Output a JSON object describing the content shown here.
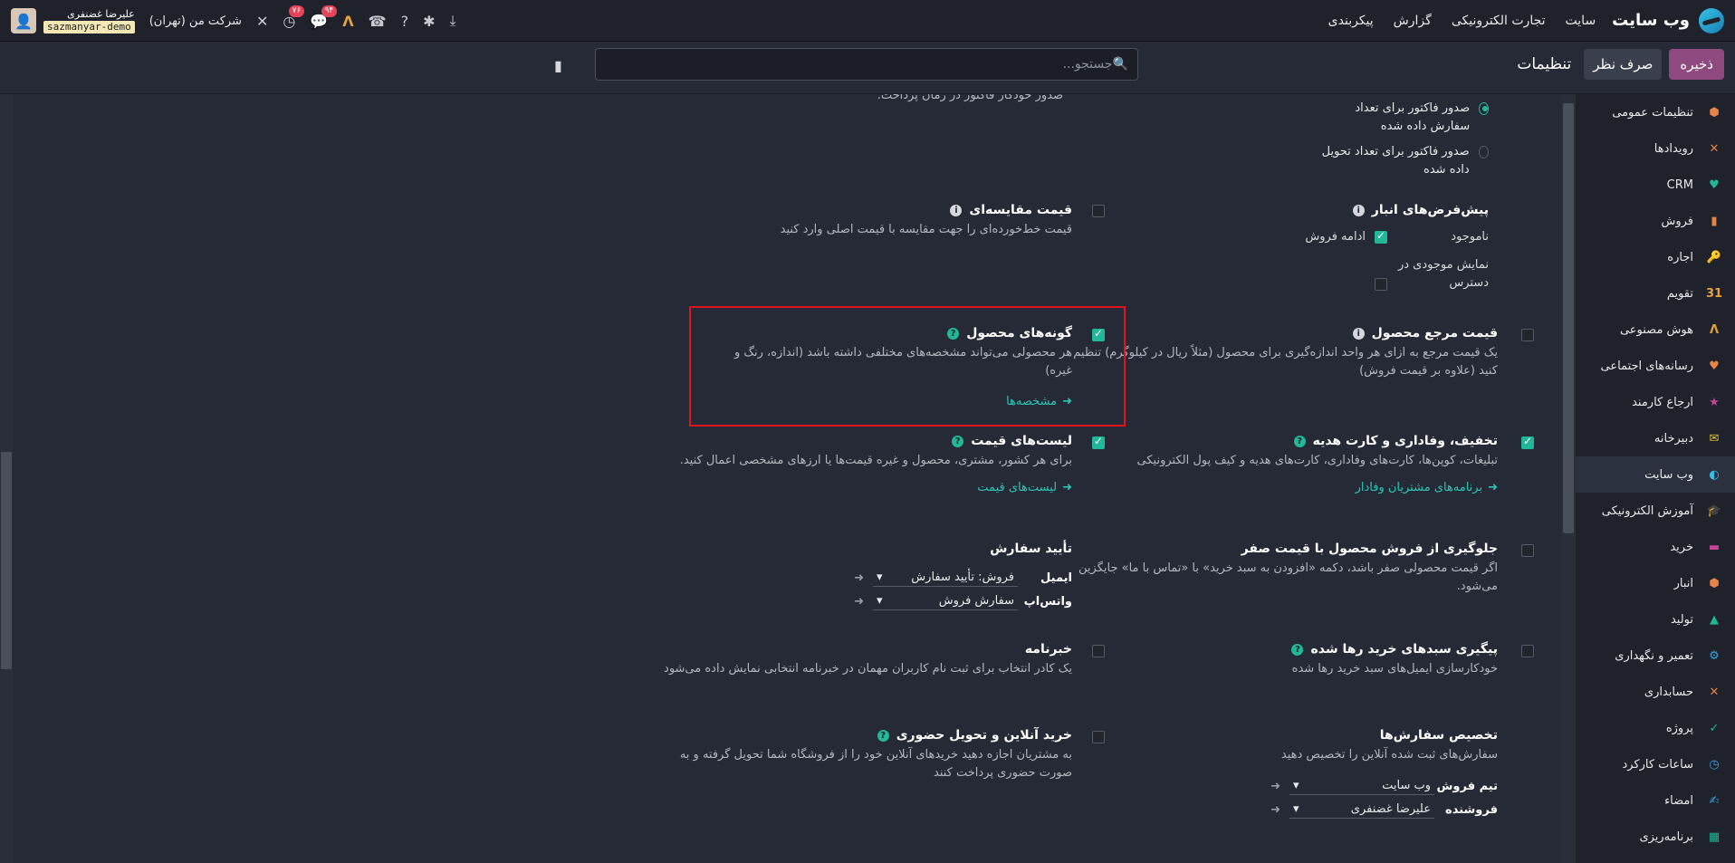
{
  "topbar": {
    "app_name": "وب سایت",
    "menu": [
      "سایت",
      "تجارت الکترونیکی",
      "گزارش",
      "پیکربندی"
    ],
    "user_name": "علیرضا غضنفری",
    "db": "sazmanyar-demo",
    "company": "شرکت من (تهران)",
    "badge_messages": "۹۴",
    "badge_activities": "۷۶"
  },
  "control": {
    "save": "ذخیره",
    "discard": "صرف نظر",
    "title": "تنظیمات",
    "search_placeholder": "جستجو..."
  },
  "sidebar": [
    {
      "label": "تنظیمات عمومی",
      "color": "#E8834A",
      "glyph": "⬢"
    },
    {
      "label": "رویدادها",
      "color": "#E8834A",
      "glyph": "✕"
    },
    {
      "label": "CRM",
      "color": "#21B799",
      "glyph": "♥"
    },
    {
      "label": "فروش",
      "color": "#E8834A",
      "glyph": "▮"
    },
    {
      "label": "اجاره",
      "color": "#C2459A",
      "glyph": "🔑"
    },
    {
      "label": "تقویم",
      "color": "#E8A23A",
      "glyph": "31"
    },
    {
      "label": "هوش مصنوعی",
      "color": "#E8A23A",
      "glyph": "Λ"
    },
    {
      "label": "رسانه‌های اجتماعی",
      "color": "#E8834A",
      "glyph": "♥"
    },
    {
      "label": "ارجاع کارمند",
      "color": "#C2459A",
      "glyph": "★"
    },
    {
      "label": "دبیرخانه",
      "color": "#E8C23A",
      "glyph": "✉"
    },
    {
      "label": "وب سایت",
      "color": "#34C3E6",
      "glyph": "◐"
    },
    {
      "label": "آموزش الکترونیکی",
      "color": "#21B799",
      "glyph": "🎓"
    },
    {
      "label": "خرید",
      "color": "#C2459A",
      "glyph": "▬"
    },
    {
      "label": "انبار",
      "color": "#E8834A",
      "glyph": "⬢"
    },
    {
      "label": "تولید",
      "color": "#21B799",
      "glyph": "▲"
    },
    {
      "label": "تعمیر و نگهداری",
      "color": "#34A3E6",
      "glyph": "⚙"
    },
    {
      "label": "حسابداری",
      "color": "#E8834A",
      "glyph": "✕"
    },
    {
      "label": "پروژه",
      "color": "#21B799",
      "glyph": "✓"
    },
    {
      "label": "ساعات کارکرد",
      "color": "#34A3E6",
      "glyph": "◷"
    },
    {
      "label": "امضاء",
      "color": "#34A3E6",
      "glyph": "✍"
    },
    {
      "label": "برنامه‌ریزی",
      "color": "#21B799",
      "glyph": "▦"
    }
  ],
  "settings": {
    "top_partial": "صدور خودکار فاکتور در زمان پرداخت.",
    "invoice_ordered": "صدور فاکتور برای تعداد سفارش داده شده",
    "invoice_delivered": "صدور فاکتور برای تعداد تحویل داده شده",
    "stock_defaults": {
      "title": "پیش‌فرض‌های انبار",
      "out_label": "ناموجود",
      "continue": "ادامه فروش",
      "show_available": "نمایش موجودی در دسترس"
    },
    "compare_price": {
      "title": "قیمت مقایسه‌ای",
      "desc": "قیمت خط‌خورده‌ای را جهت مقایسه با قیمت اصلی وارد کنید"
    },
    "ref_price": {
      "title": "قیمت مرجع محصول",
      "desc": "یک قیمت مرجع به ازای هر واحد اندازه‌گیری برای محصول (مثلاً ریال در کیلوگرم) تنظیم کنید (علاوه بر قیمت فروش)"
    },
    "variants": {
      "title": "گونه‌های محصول",
      "desc": "هر محصولی می‌تواند مشخصه‌های مختلفی داشته باشد (اندازه، رنگ و غیره)",
      "link": "مشخصه‌ها"
    },
    "loyalty": {
      "title": "تخفیف، وفاداری و کارت هدیه",
      "desc": "تبلیغات، کوپن‌ها، کارت‌های وفاداری، کارت‌های هدیه و کیف پول الکترونیکی",
      "link": "برنامه‌های مشتریان وفادار"
    },
    "pricelists": {
      "title": "لیست‌های قیمت",
      "desc": "برای هر کشور، مشتری، محصول و غیره قیمت‌ها یا ارزهای مشخصی اعمال کنید.",
      "link": "لیست‌های قیمت"
    },
    "zero_price": {
      "title": "جلوگیری از فروش محصول با قیمت صفر",
      "desc": "اگر قیمت محصولی صفر باشد، دکمه «افزودن به سبد خرید» با «تماس با ما» جایگزین می‌شود."
    },
    "order_confirm": {
      "title": "تأیید سفارش",
      "email_label": "ایمیل",
      "email_value": "فروش: تأیید سفارش",
      "whatsapp_label": "واتس‌اپ",
      "whatsapp_value": "سفارش فروش"
    },
    "abandoned": {
      "title": "پیگیری سبدهای خرید رها شده",
      "desc": "خودکارسازی ایمیل‌های سبد خرید رها شده"
    },
    "newsletter": {
      "title": "خبرنامه",
      "desc": "یک کادر انتخاب برای ثبت نام کاربران مهمان در خبرنامه انتخابی نمایش داده می‌شود"
    },
    "assign": {
      "title": "تخصیص سفارش‌ها",
      "desc": "سفارش‌های ثبت شده آنلاین را تخصیص دهید",
      "team_label": "تیم فروش",
      "team_value": "وب سایت",
      "seller_label": "فروشنده",
      "seller_value": "علیرضا غضنفری"
    },
    "pickup": {
      "title": "خرید آنلاین و تحویل حضوری",
      "desc": "به مشتریان اجازه دهید خریدهای آنلاین خود را از فروشگاه شما تحویل گرفته و به صورت حضوری پرداخت کنند"
    }
  }
}
